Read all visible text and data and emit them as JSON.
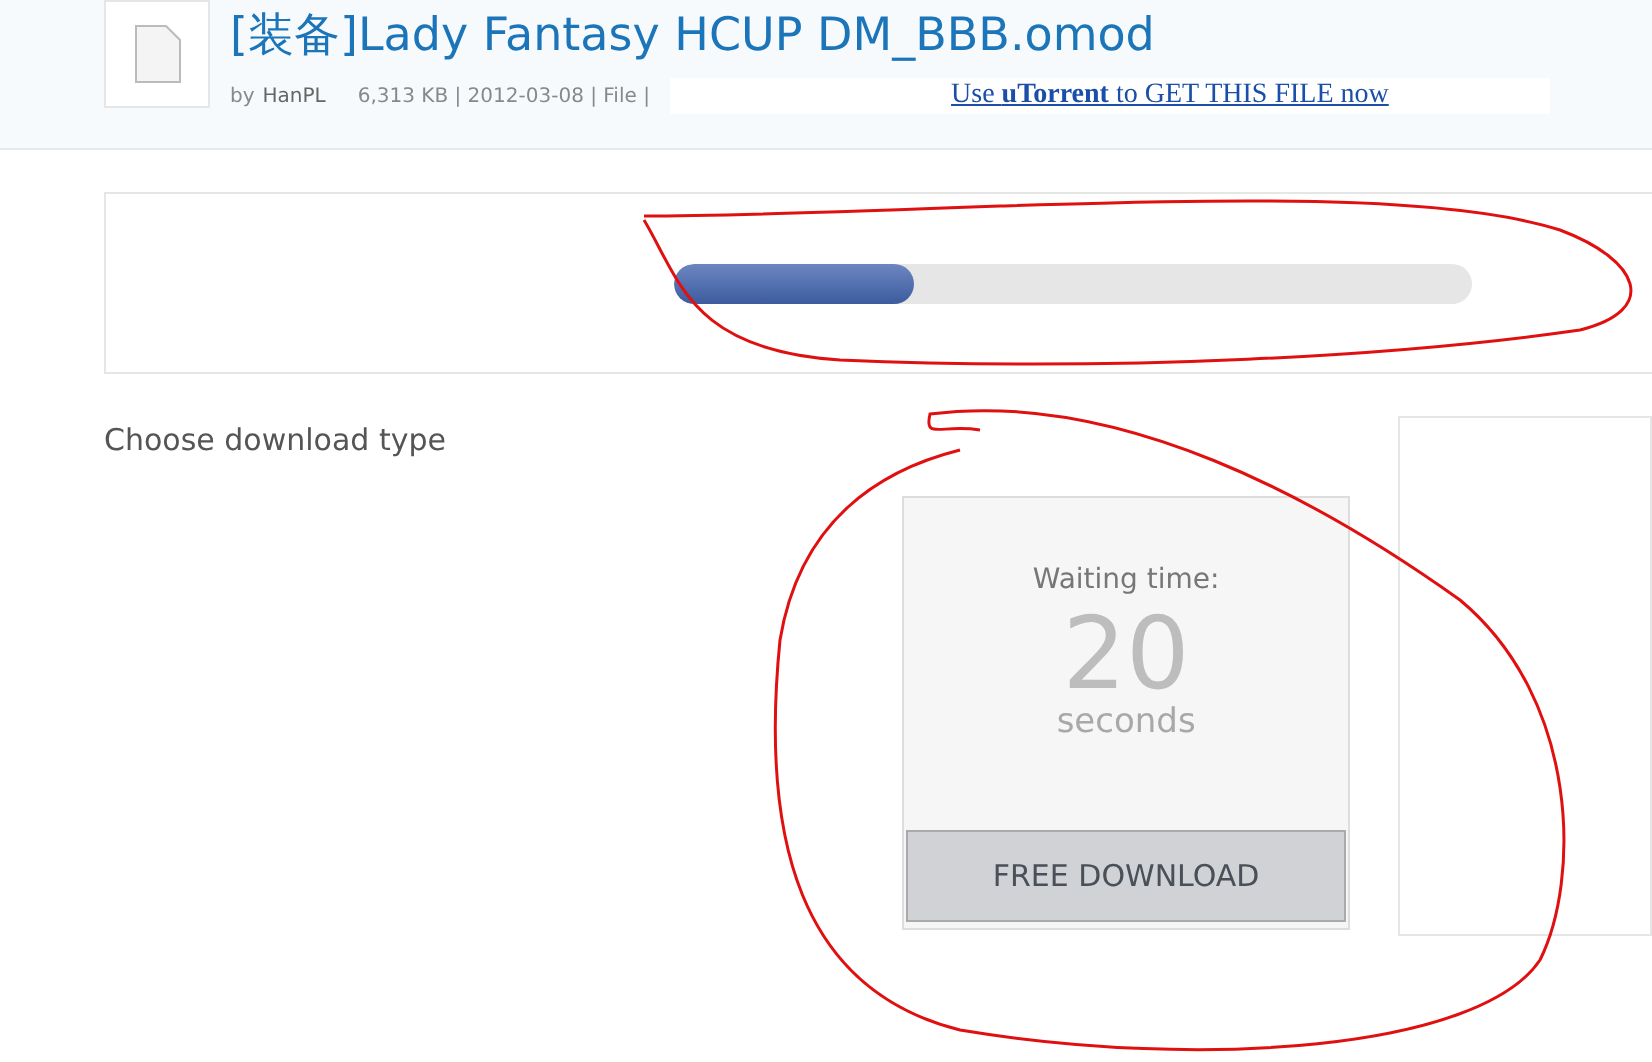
{
  "file": {
    "title": "[装备]Lady Fantasy HCUP DM_BBB.omod",
    "by": "by",
    "uploader": "HanPL",
    "meta": "6,313 KB | 2012-03-08 | File |"
  },
  "ad_link": "Use **uTorrent** to GET THIS FILE now",
  "progress": {
    "level": 0.3
  },
  "section_title": "Choose download type",
  "waiting": {
    "label": "Waiting time:",
    "count": "20",
    "unit": "seconds",
    "button": "FREE DOWNLOAD"
  }
}
